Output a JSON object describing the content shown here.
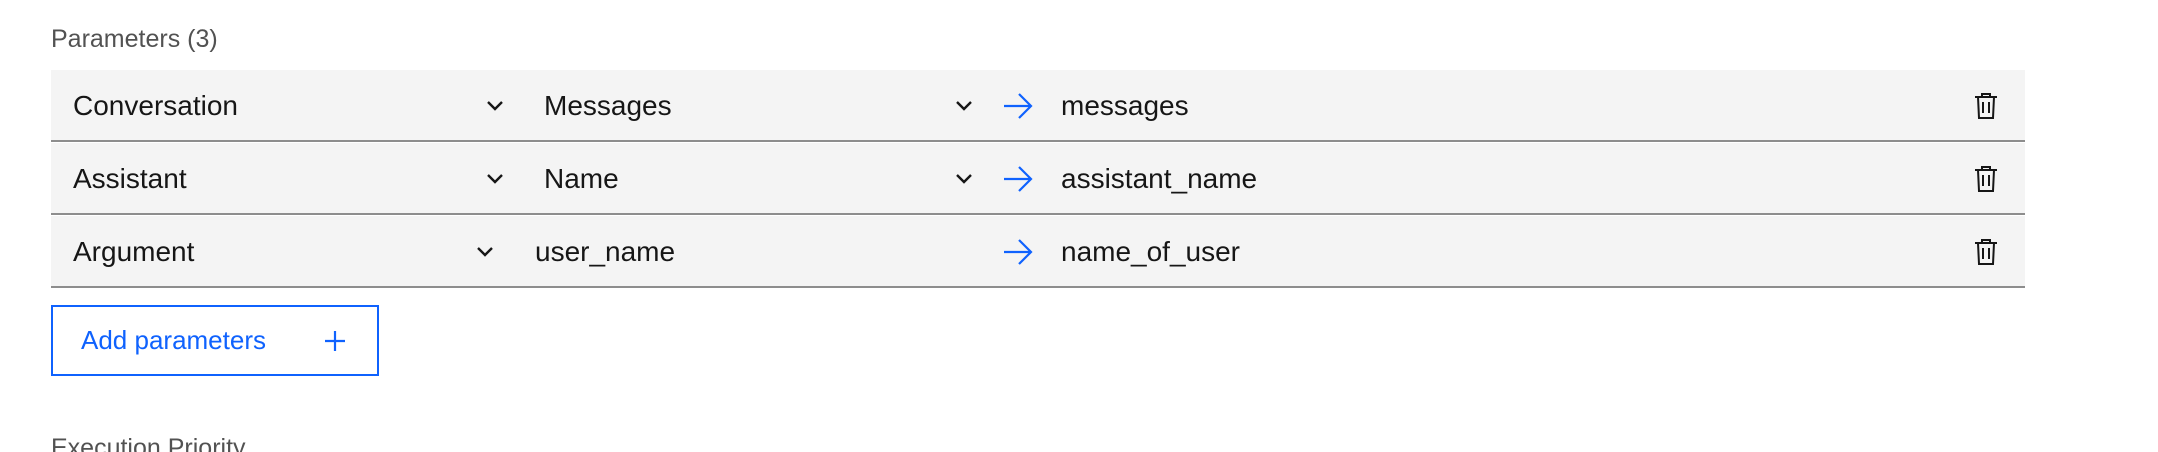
{
  "parameters": {
    "heading": "Parameters (3)",
    "rows": [
      {
        "source": "Conversation",
        "field": "Messages",
        "target": "messages"
      },
      {
        "source": "Assistant",
        "field": "Name",
        "target": "assistant_name"
      },
      {
        "source": "Argument",
        "field": "user_name",
        "target": "name_of_user"
      }
    ],
    "add_label": "Add parameters"
  },
  "next_section": {
    "heading": "Execution Priority"
  },
  "colors": {
    "accent": "#0f62fe",
    "row_bg": "#f4f4f4",
    "row_border": "#8d8d8d",
    "text": "#161616",
    "muted": "#525252"
  },
  "icons": {
    "dropdown": "chevron-down-icon",
    "mapping": "arrow-right-icon",
    "delete": "trash-icon",
    "add": "plus-icon"
  }
}
